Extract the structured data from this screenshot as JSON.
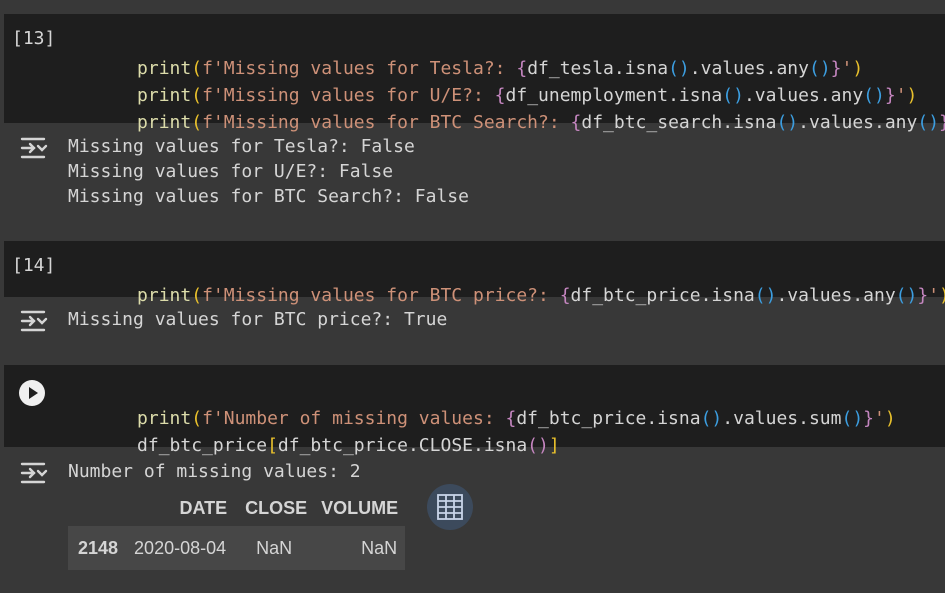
{
  "cell13": {
    "exec_count": "[13]",
    "lines": [
      {
        "pre": "print",
        "s1": "f'Missing values for Tesla?: ",
        "expr": "df_tesla.isna",
        "mid": ".values.any",
        "end": "'"
      },
      {
        "pre": "print",
        "s1": "f'Missing values for U/E?: ",
        "expr": "df_unemployment.isna",
        "mid": ".values.any",
        "end": "'"
      },
      {
        "pre": "print",
        "s1": "f'Missing values for BTC Search?: ",
        "expr": "df_btc_search.isna",
        "mid": ".values.any",
        "end": "'"
      }
    ],
    "output": [
      "Missing values for Tesla?: False",
      "Missing values for U/E?: False",
      "Missing values for BTC Search?: False"
    ]
  },
  "cell14": {
    "exec_count": "[14]",
    "line": {
      "pre": "print",
      "s1": "f'Missing values for BTC price?: ",
      "expr": "df_btc_price.isna",
      "mid": ".values.any",
      "end": "'"
    },
    "output": [
      "Missing values for BTC price?: True"
    ]
  },
  "cell15": {
    "line1": {
      "pre": "print",
      "s1": "f'Number of missing values: ",
      "expr": "df_btc_price.isna",
      "mid": ".values.sum",
      "end": "'"
    },
    "line2": {
      "a": "df_btc_price",
      "b": "df_btc_price.CLOSE.isna"
    },
    "output": [
      "Number of missing values: 2"
    ],
    "table": {
      "columns": [
        "",
        "DATE",
        "CLOSE",
        "VOLUME"
      ],
      "rows": [
        [
          "2148",
          "2020-08-04",
          "NaN",
          "NaN"
        ]
      ]
    }
  },
  "icons": {
    "output": "output-expand-icon",
    "run": "play-icon",
    "table": "table-view-icon"
  },
  "colors": {
    "background": "#383838",
    "cell": "#1e1e1e",
    "keyword": "#dcdcaa",
    "string": "#ce9178",
    "paren": "#e8c02c",
    "brace": "#c586c0"
  }
}
